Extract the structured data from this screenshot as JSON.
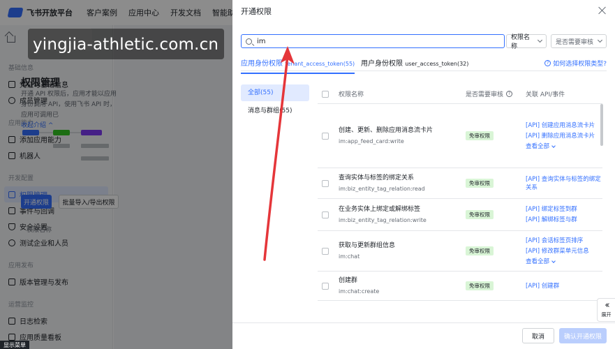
{
  "topnav": {
    "logo_text": "飞书开放平台",
    "items": [
      "客户案例",
      "应用中心",
      "开发文档",
      "智能助"
    ]
  },
  "sidebar": {
    "groups": [
      {
        "title": "基础信息",
        "items": [
          {
            "label": "凭证与基础信息",
            "icon": "credentials-icon"
          },
          {
            "label": "成员管理",
            "icon": "members-icon"
          }
        ]
      },
      {
        "title": "应用能力",
        "items": [
          {
            "label": "添加应用能力",
            "icon": "add-ability-icon"
          },
          {
            "label": "机器人",
            "icon": "robot-icon"
          }
        ]
      },
      {
        "title": "开发配置",
        "items": [
          {
            "label": "权限管理",
            "icon": "permission-icon",
            "active": true
          },
          {
            "label": "事件与回调",
            "icon": "events-icon"
          },
          {
            "label": "安全设置",
            "icon": "security-icon"
          },
          {
            "label": "测试企业和人员",
            "icon": "test-icon"
          }
        ]
      },
      {
        "title": "应用发布",
        "items": [
          {
            "label": "版本管理与发布",
            "icon": "version-icon"
          }
        ]
      },
      {
        "title": "运营监控",
        "items": [
          {
            "label": "日志检索",
            "icon": "log-icon"
          },
          {
            "label": "应用质量看板",
            "icon": "dashboard-icon"
          }
        ]
      }
    ]
  },
  "content": {
    "title": "权限管理",
    "desc": "开通 API 权限后，应用才能以应用身份调用 API，使用飞书 API 时，应用可调用已",
    "collapse_link": "收起介绍",
    "btn_open": "开通权限",
    "btn_import": "批量导入/导出权限",
    "col_name": "权限名称"
  },
  "watermark": "yingjia-athletic.com.cn",
  "show_menu": "显示菜单",
  "drawer": {
    "title": "开通权限",
    "search": {
      "value": "im",
      "placeholder": ""
    },
    "select_name": "权限名称",
    "select_review": "是否需要审核",
    "tabs": {
      "app": "应用身份权限",
      "app_sub": "tenant_access_token(55)",
      "user": "用户身份权限",
      "user_sub": "user_access_token(32)"
    },
    "help": "如何选择权限类型?",
    "categories": [
      "全部(55)",
      "消息与群组(55)"
    ],
    "table": {
      "headers": {
        "name": "权限名称",
        "review": "是否需要审核",
        "api": "关联 API/事件"
      },
      "rows": [
        {
          "name": "创建、更新、删除应用消息流卡片",
          "code": "im:app_feed_card:write",
          "badge": "免审权限",
          "apis": [
            "[API] 创建应用消息流卡片",
            "[API] 删除应用消息流卡片"
          ],
          "more": "查看全部"
        },
        {
          "name": "查询实体与标签的绑定关系",
          "code": "im:biz_entity_tag_relation:read",
          "badge": "免审权限",
          "apis": [
            "[API] 查询实体与标签的绑定关系"
          ],
          "more": ""
        },
        {
          "name": "在业务实体上绑定或解绑标签",
          "code": "im:biz_entity_tag_relation:write",
          "badge": "免审权限",
          "apis": [
            "[API] 绑定标签到群",
            "[API] 解绑标签与群"
          ],
          "more": ""
        },
        {
          "name": "获取与更新群组信息",
          "code": "im:chat",
          "badge": "免审权限",
          "apis": [
            "[API] 会话标签页排序",
            "[API] 修改群菜单元信息"
          ],
          "more": "查看全部"
        },
        {
          "name": "创建群",
          "code": "im:chat:create",
          "badge": "免审权限",
          "apis": [
            "[API] 创建群"
          ],
          "more": ""
        }
      ]
    },
    "expand_label": "展开",
    "cancel": "取消",
    "confirm": "确认开通权限"
  },
  "colors": {
    "accent": "#3370ff",
    "badge_bg": "#d9f5d6",
    "arrow": "#e5363a"
  }
}
